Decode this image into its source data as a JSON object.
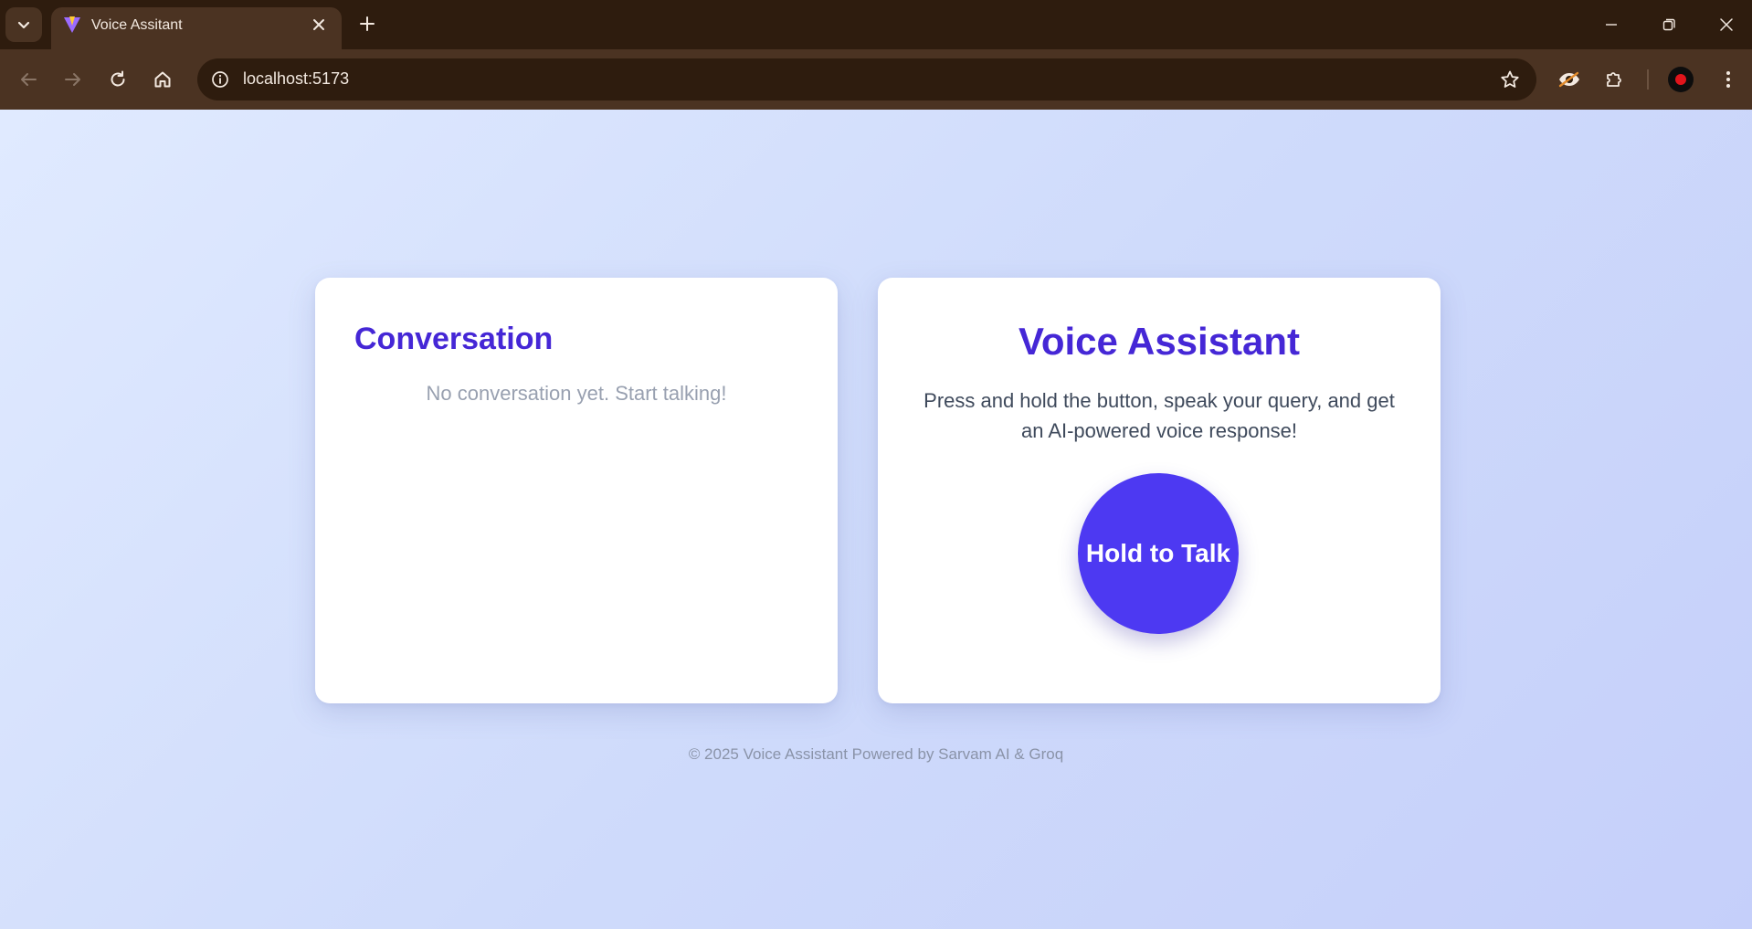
{
  "browser": {
    "tab_title": "Voice Assitant",
    "url": "localhost:5173",
    "icons": {
      "tab_search": "chevron-down-icon",
      "favicon": "vite-logo-icon",
      "tab_close": "close-icon",
      "new_tab": "plus-icon",
      "minimize": "minimize-icon",
      "restore": "restore-icon",
      "close": "close-icon",
      "back": "arrow-left-icon",
      "forward": "arrow-right-icon",
      "reload": "reload-icon",
      "home": "home-icon",
      "site_info": "info-icon",
      "bookmark": "star-icon",
      "extension_1": "eye-extension-icon",
      "extensions": "puzzle-icon",
      "menu": "kebab-menu-icon"
    }
  },
  "conversation": {
    "title": "Conversation",
    "empty_text": "No conversation yet. Start talking!"
  },
  "assistant": {
    "title": "Voice Assistant",
    "description": "Press and hold the button, speak your query, and get an AI-powered voice response!",
    "button_label": "Hold to Talk"
  },
  "footer": {
    "text": "© 2025 Voice Assistant Powered by Sarvam AI & Groq"
  },
  "colors": {
    "accent": "#4527d6",
    "button": "#4d39f2",
    "chrome_dark": "#2e1c0e",
    "chrome_toolbar": "#4b3322"
  }
}
